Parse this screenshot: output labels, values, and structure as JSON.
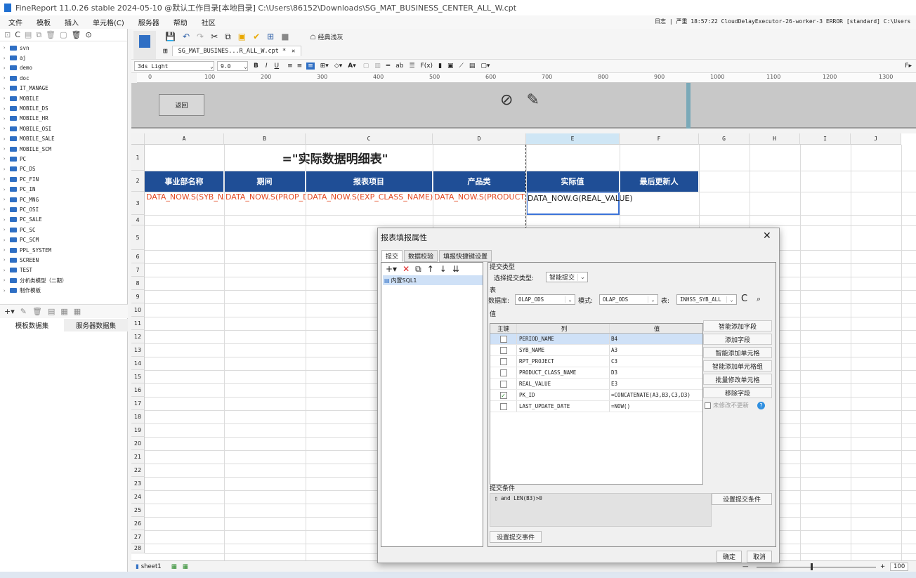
{
  "window": {
    "title": "FineReport 11.0.26 stable 2024-05-10 @默认工作目录[本地目录]   C:\\Users\\86152\\Downloads\\SG_MAT_BUSINESS_CENTER_ALL_W.cpt"
  },
  "menu": {
    "items": [
      "文件",
      "模板",
      "插入",
      "单元格(C)",
      "服务器",
      "帮助",
      "社区"
    ],
    "log": "日志 | 严重 18:57:22 CloudDelayExecutor-26-worker-3 ERROR [standard] C:\\Users"
  },
  "tree": {
    "items": [
      "svn",
      "aj",
      "demo",
      "doc",
      "IT_MANAGE",
      "MOBILE",
      "MOBILE_DS",
      "MOBILE_HR",
      "MOBILE_OSI",
      "MOBILE_SALE",
      "MOBILE_SCM",
      "PC",
      "PC_DS",
      "PC_FIN",
      "PC_IN",
      "PC_MNG",
      "PC_OSI",
      "PC_SALE",
      "PC_SC",
      "PC_SCM",
      "PPL_SYSTEM",
      "SCREEN",
      "TEST",
      "分析类模型（二期）",
      "制作模板"
    ],
    "tabs": [
      "模板数据集",
      "服务器数据集"
    ]
  },
  "toolbar": {
    "style_label": "经典浅灰"
  },
  "doc_tab": {
    "name": "SG_MAT_BUSINES...R_ALL_W.cpt *"
  },
  "format": {
    "font": "3ds Light",
    "size": "9.0"
  },
  "ruler": [
    "0",
    "100",
    "200",
    "300",
    "400",
    "500",
    "600",
    "700",
    "800",
    "900",
    "1000",
    "1100",
    "1200",
    "1300"
  ],
  "param": {
    "back_label": "返回"
  },
  "sheet": {
    "columns": [
      "A",
      "B",
      "C",
      "D",
      "E",
      "F",
      "G",
      "H",
      "I",
      "J"
    ],
    "rows": [
      "1",
      "2",
      "3",
      "4",
      "5",
      "6",
      "7",
      "8",
      "9",
      "10",
      "11",
      "12",
      "13",
      "14",
      "15",
      "16",
      "17",
      "18",
      "19",
      "20",
      "21",
      "22",
      "23",
      "24",
      "25",
      "26",
      "27",
      "28"
    ],
    "title": "=\"实际数据明细表\"",
    "headers": [
      "事业部名称",
      "期间",
      "报表项目",
      "产品类",
      "实际值",
      "最后更新人"
    ],
    "row3": [
      "DATA_NOW.S(SYB_NAME)",
      "DATA_NOW.S(PROP_DATE)",
      "DATA_NOW.S(EXP_CLASS_NAME)",
      "DATA_NOW.S(PRODUCT_CLASS",
      "DATA_NOW.G(REAL_VALUE)"
    ],
    "sheet_tab": "sheet1",
    "zoom": "100"
  },
  "dialog": {
    "title": "报表填报属性",
    "tabs": [
      "提交",
      "数据校验",
      "填报快捷键设置"
    ],
    "sql_item": "内置SQL1",
    "submit_type_group": "提交类型",
    "submit_type_label": "选择提交类型:",
    "submit_type_value": "智能提交",
    "table_group": "表",
    "db_label": "数据库:",
    "db_value": "OLAP_ODS",
    "schema_label": "模式:",
    "schema_value": "OLAP_ODS",
    "table_label": "表:",
    "table_value": "INHSS_SYB_ALL",
    "value_group": "值",
    "col_headers": [
      "主键",
      "列",
      "值"
    ],
    "rows": [
      {
        "key": false,
        "col": "PERIOD_NAME",
        "val": "B4"
      },
      {
        "key": false,
        "col": "SYB_NAME",
        "val": "A3"
      },
      {
        "key": false,
        "col": "RPT_PROJECT",
        "val": "C3"
      },
      {
        "key": false,
        "col": "PRODUCT_CLASS_NAME",
        "val": "D3"
      },
      {
        "key": false,
        "col": "REAL_VALUE",
        "val": "E3"
      },
      {
        "key": true,
        "col": "PK_ID",
        "val": "=CONCATENATE(A3,B3,C3,D3)"
      },
      {
        "key": false,
        "col": "LAST_UPDATE_DATE",
        "val": "=NOW()"
      }
    ],
    "side_buttons": [
      "智能添加字段",
      "添加字段",
      "智能添加单元格",
      "智能添加单元格组",
      "批量修改单元格",
      "移除字段"
    ],
    "unchanged_label": "未修改不更新",
    "cond_group": "提交条件",
    "cond_text": "and LEN(B3)>0",
    "set_cond_btn": "设置提交条件",
    "set_event_btn": "设置提交事件",
    "ok": "确定",
    "cancel": "取消"
  }
}
